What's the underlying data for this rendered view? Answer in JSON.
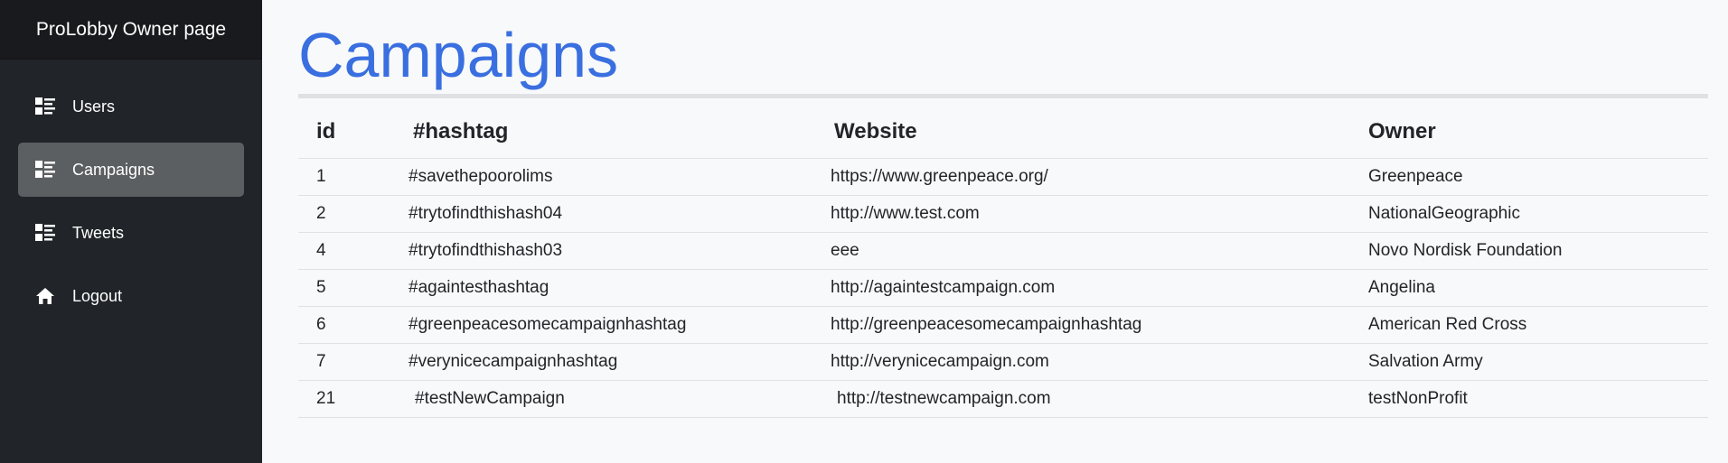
{
  "brand": {
    "title": "ProLobby Owner page"
  },
  "sidebar": {
    "items": [
      {
        "label": "Users",
        "icon": "list-icon",
        "active": false
      },
      {
        "label": "Campaigns",
        "icon": "list-icon",
        "active": true
      },
      {
        "label": "Tweets",
        "icon": "list-icon",
        "active": false
      },
      {
        "label": "Logout",
        "icon": "home-icon",
        "active": false
      }
    ]
  },
  "main": {
    "title": "Campaigns",
    "table": {
      "headers": [
        "id",
        "#hashtag",
        "Website",
        "Owner"
      ],
      "rows": [
        {
          "id": "1",
          "hashtag": "#savethepoorolims",
          "website": "https://www.greenpeace.org/",
          "owner": "Greenpeace"
        },
        {
          "id": "2",
          "hashtag": "#trytofindthishash04",
          "website": "http://www.test.com",
          "owner": "NationalGeographic"
        },
        {
          "id": "4",
          "hashtag": "#trytofindthishash03",
          "website": "eee",
          "owner": "Novo Nordisk Foundation"
        },
        {
          "id": "5",
          "hashtag": "#againtesthashtag",
          "website": "http://againtestcampaign.com",
          "owner": "Angelina"
        },
        {
          "id": "6",
          "hashtag": "#greenpeacesomecampaignhashtag",
          "website": "http://greenpeacesomecampaignhashtag",
          "owner": "American Red Cross"
        },
        {
          "id": "7",
          "hashtag": "#verynicecampaignhashtag",
          "website": "http://verynicecampaign.com",
          "owner": "Salvation Army"
        },
        {
          "id": "21",
          "hashtag": "#testNewCampaign",
          "website": "http://testnewcampaign.com",
          "owner": "testNonProfit"
        }
      ]
    }
  },
  "colors": {
    "sidebar_bg": "#212529",
    "brand_bg": "#181a1d",
    "active_item_bg": "#5c5f62",
    "title_blue": "#3a6fe0",
    "page_bg": "#f8f9fa"
  }
}
